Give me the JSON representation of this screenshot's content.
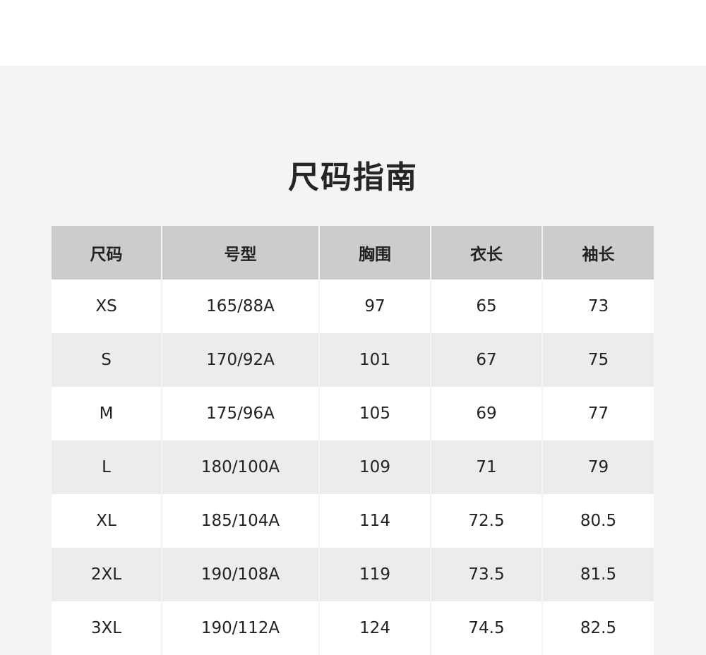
{
  "title": "尺码指南",
  "table": {
    "headers": [
      "尺码",
      "号型",
      "胸围",
      "衣长",
      "袖长"
    ],
    "rows": [
      [
        "XS",
        "165/88A",
        "97",
        "65",
        "73"
      ],
      [
        "S",
        "170/92A",
        "101",
        "67",
        "75"
      ],
      [
        "M",
        "175/96A",
        "105",
        "69",
        "77"
      ],
      [
        "L",
        "180/100A",
        "109",
        "71",
        "79"
      ],
      [
        "XL",
        "185/104A",
        "114",
        "72.5",
        "80.5"
      ],
      [
        "2XL",
        "190/108A",
        "119",
        "73.5",
        "81.5"
      ],
      [
        "3XL",
        "190/112A",
        "124",
        "74.5",
        "82.5"
      ]
    ]
  },
  "colors": {
    "header_bg": "#cccccc",
    "row_odd_bg": "#ffffff",
    "row_even_bg": "#ececec",
    "panel_bg": "#f4f4f4"
  }
}
